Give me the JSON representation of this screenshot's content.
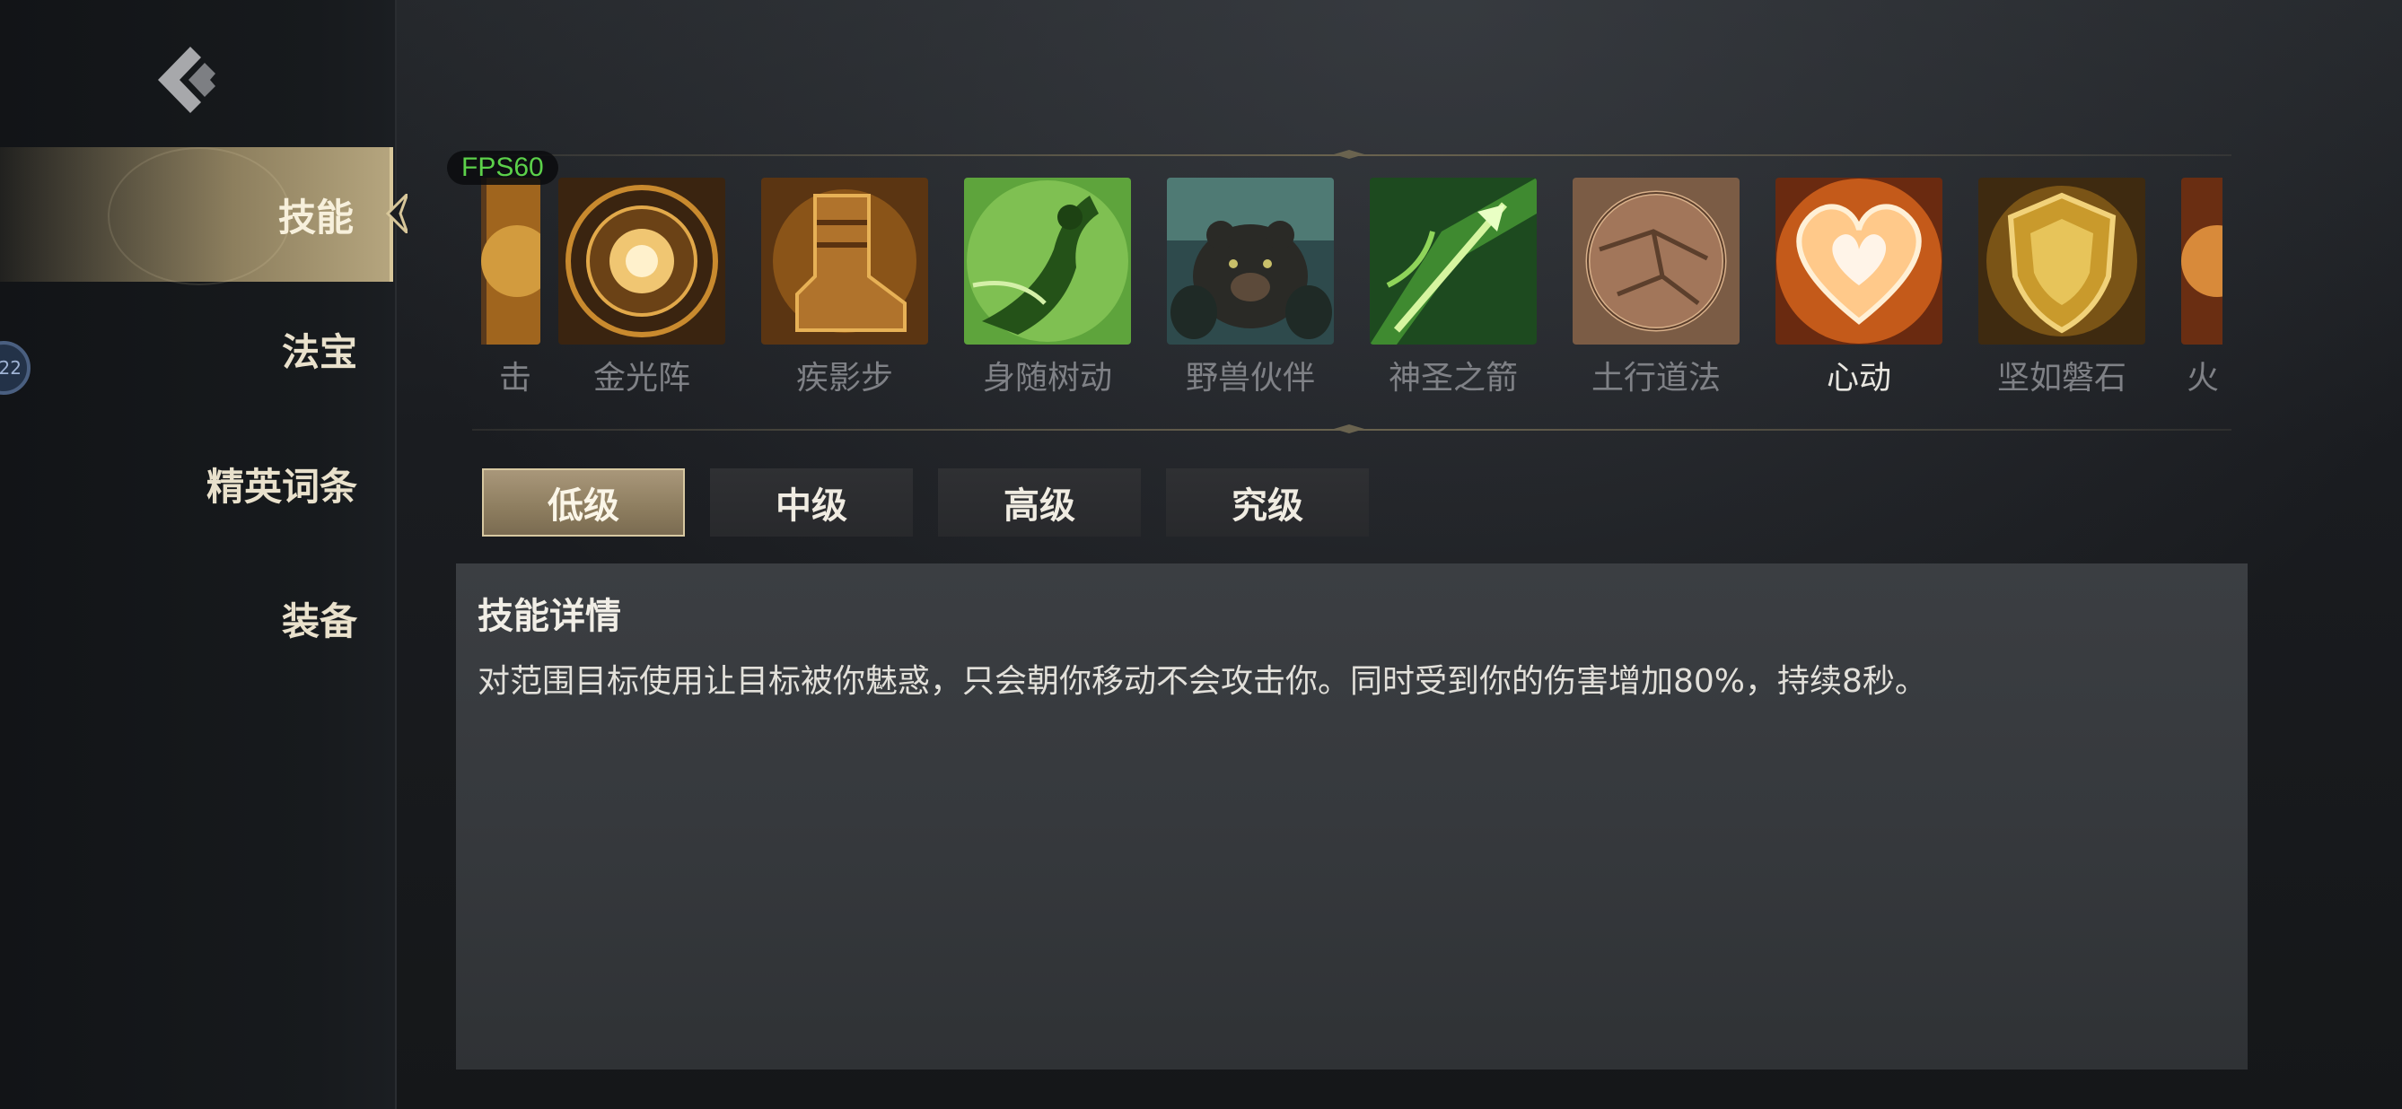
{
  "fps": "FPS60",
  "sidebar": {
    "items": [
      {
        "label": "技能"
      },
      {
        "label": "法宝"
      },
      {
        "label": "精英词条"
      },
      {
        "label": "装备"
      }
    ],
    "badge": "22"
  },
  "skills": [
    {
      "label": "击",
      "icon": "partial-skill-icon"
    },
    {
      "label": "金光阵",
      "icon": "golden-circle-icon"
    },
    {
      "label": "疾影步",
      "icon": "boot-icon"
    },
    {
      "label": "身随树动",
      "icon": "leaping-figure-icon"
    },
    {
      "label": "野兽伙伴",
      "icon": "bear-icon"
    },
    {
      "label": "神圣之箭",
      "icon": "arrow-icon"
    },
    {
      "label": "土行道法",
      "icon": "earth-orb-icon"
    },
    {
      "label": "心动",
      "icon": "heart-icon"
    },
    {
      "label": "坚如磐石",
      "icon": "shield-icon"
    },
    {
      "label": "火",
      "icon": "partial-fire-icon"
    }
  ],
  "selected_skill": "心动",
  "tabs": [
    {
      "label": "低级"
    },
    {
      "label": "中级"
    },
    {
      "label": "高级"
    },
    {
      "label": "究级"
    }
  ],
  "active_tab": "低级",
  "detail": {
    "title": "技能详情",
    "text": "对范围目标使用让目标被你魅惑，只会朝你移动不会攻击你。同时受到你的伤害增加80%，持续8秒。"
  },
  "colors": {
    "accent_gold": "#b5a57e",
    "fps_green": "#5cd14a",
    "panel_bg": "#3b3e42"
  }
}
